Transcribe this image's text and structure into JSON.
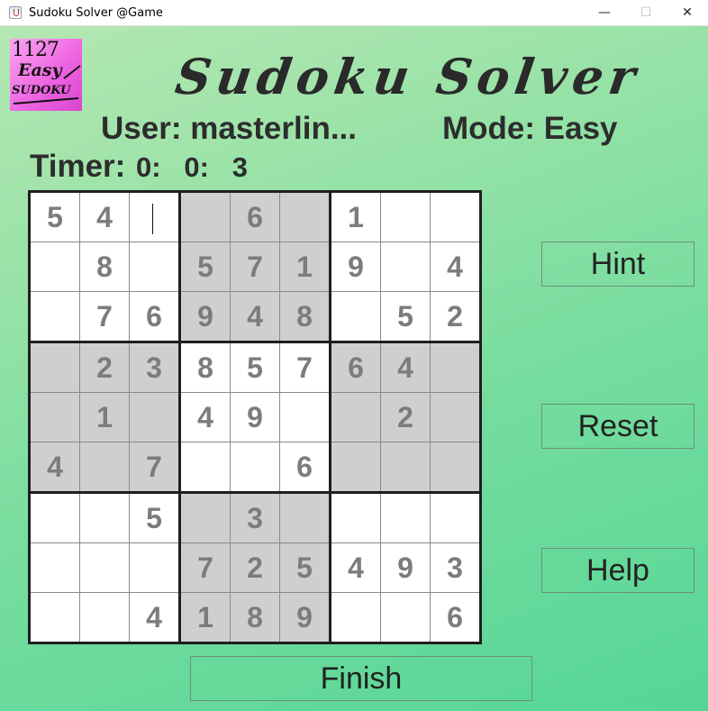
{
  "window": {
    "title": "Sudoku Solver @Game",
    "minimize": "—",
    "maximize": "☐",
    "close": "✕"
  },
  "logo": {
    "line1": "1127",
    "line2": "Easy",
    "line3": "SUDOKU"
  },
  "app_title": "Sudoku Solver",
  "user_text": "User: masterlin...",
  "mode_text": "Mode: Easy",
  "timer": {
    "label": "Timer:",
    "display": "0:   0:   3"
  },
  "board": {
    "rows": [
      [
        "5",
        "4",
        "",
        "",
        "6",
        "",
        "1",
        "",
        ""
      ],
      [
        "",
        "8",
        "",
        "5",
        "7",
        "1",
        "9",
        "",
        "4"
      ],
      [
        "",
        "7",
        "6",
        "9",
        "4",
        "8",
        "",
        "5",
        "2"
      ],
      [
        "",
        "2",
        "3",
        "8",
        "5",
        "7",
        "6",
        "4",
        ""
      ],
      [
        "",
        "1",
        "",
        "4",
        "9",
        "",
        "",
        "2",
        ""
      ],
      [
        "4",
        "",
        "7",
        "",
        "",
        "6",
        "",
        "",
        ""
      ],
      [
        "",
        "",
        "5",
        "",
        "3",
        "",
        "",
        "",
        ""
      ],
      [
        "",
        "",
        "",
        "7",
        "2",
        "5",
        "4",
        "9",
        "3"
      ],
      [
        "",
        "",
        "4",
        "1",
        "8",
        "9",
        "",
        "",
        "6"
      ]
    ],
    "shaded_boxes": [
      1,
      3,
      5,
      7
    ],
    "cursor_cell": [
      0,
      2
    ]
  },
  "buttons": {
    "hint": "Hint",
    "reset": "Reset",
    "help": "Help",
    "finish": "Finish"
  },
  "colors": {
    "background_top": "#b5e7b3",
    "background_bottom": "#55d696",
    "shaded_box": "#cfcfcf",
    "digit": "#7c7c7c",
    "logo": "#ee66e2"
  }
}
